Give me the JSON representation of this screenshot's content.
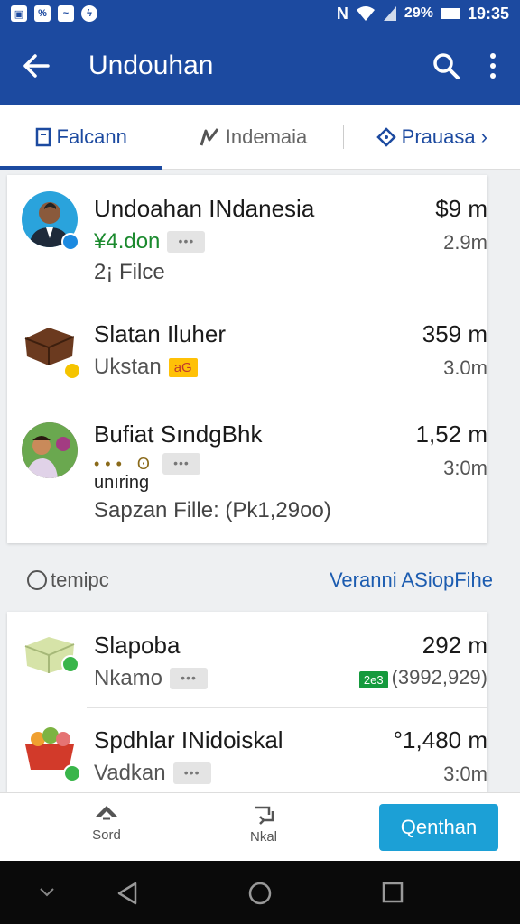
{
  "status_bar": {
    "battery": "29%",
    "time": "19:35",
    "network": "N"
  },
  "app_bar": {
    "title": "Undouhan"
  },
  "tabs": [
    {
      "label": "Falcann",
      "icon": "document-icon"
    },
    {
      "label": "Indemaia",
      "icon": "pen-icon"
    },
    {
      "label": "Prauasa ›",
      "icon": "tag-icon"
    }
  ],
  "list_top": [
    {
      "name": "Undoahan INdanesia",
      "sub": "¥4.don",
      "size": "$9 m",
      "size2": "2.9m",
      "extra": "2¡ Filce"
    },
    {
      "name": "Slatan Iluher",
      "sub": "Ukstan",
      "badge": "aG",
      "size": "359 m",
      "size2": "3.0m"
    },
    {
      "name": "Bufiat SındgBhk",
      "sub_top": "unıring",
      "size": "1,52 m",
      "size2": "3:0m",
      "extra": "Sapzan Fille: (Pk1,29oo)"
    }
  ],
  "section": {
    "left_label": "temipc",
    "right_link": "Veranni ASiopFihe"
  },
  "list_bottom": [
    {
      "name": "Slapoba",
      "sub": "Nkamo",
      "size": "292 m",
      "badge": "2e3",
      "size2": "(3992,929)"
    },
    {
      "name": "Spdhlar INidoiskal",
      "sub": "Vadkan",
      "size": "°1,480 m",
      "size2": "3:0m"
    }
  ],
  "action_bar": {
    "sort_label": "Sord",
    "next_label": "Nkal",
    "primary_label": "Qenthan"
  },
  "colors": {
    "primary": "#1c4aa0",
    "accent": "#1ca0d6",
    "green": "#159a3d",
    "yellow": "#ffc107"
  }
}
